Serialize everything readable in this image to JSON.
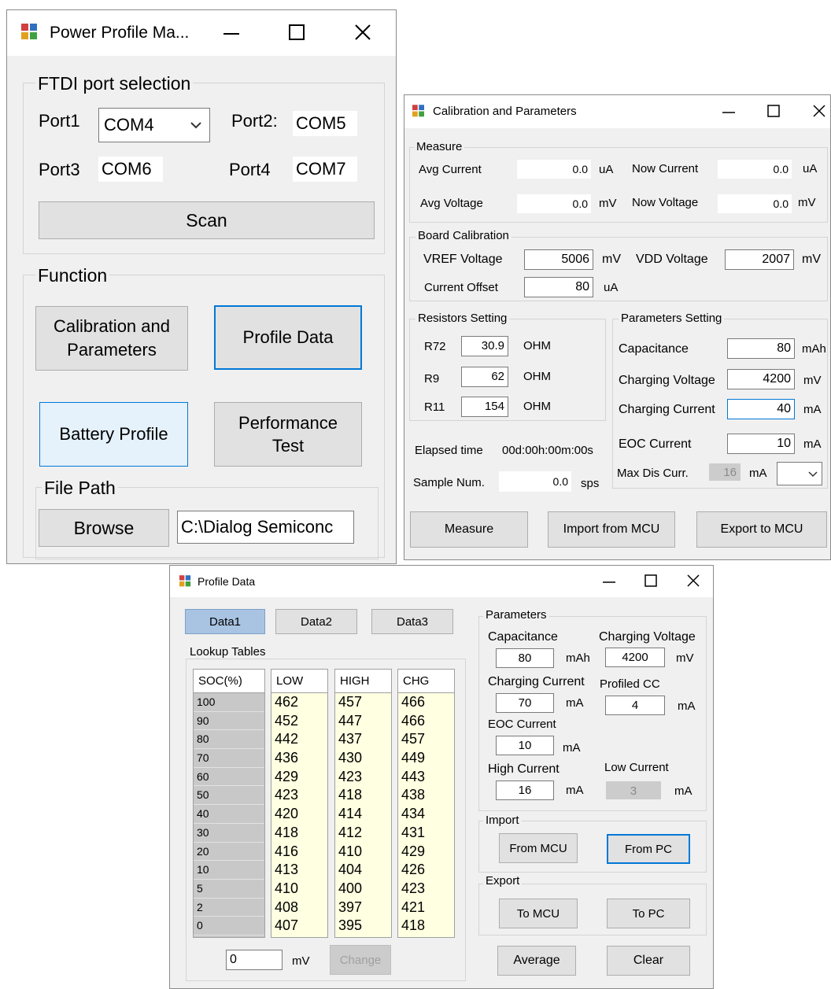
{
  "power_window": {
    "title": "Power Profile Ma...",
    "ftdi_group_label": "FTDI port selection",
    "port1_label": "Port1",
    "port1_value": "COM4",
    "port2_label": "Port2:",
    "port2_value": "COM5",
    "port3_label": "Port3",
    "port3_value": "COM6",
    "port4_label": "Port4",
    "port4_value": "COM7",
    "scan_label": "Scan",
    "function_group_label": "Function",
    "calibration_line1": "Calibration and",
    "calibration_line2": "Parameters",
    "profile_data_label": "Profile Data",
    "battery_profile_label": "Battery Profile",
    "performance_line1": "Performance",
    "performance_line2": "Test",
    "file_path_group_label": "File Path",
    "browse_label": "Browse",
    "file_path_value": "C:\\Dialog Semiconc"
  },
  "calibration_window": {
    "title": "Calibration and Parameters",
    "measure_group_label": "Measure",
    "avg_current_label": "Avg Current",
    "avg_current_value": "0.0",
    "avg_current_unit": "uA",
    "now_current_label": "Now Current",
    "now_current_value": "0.0",
    "now_current_unit": "uA",
    "avg_voltage_label": "Avg Voltage",
    "avg_voltage_value": "0.0",
    "avg_voltage_unit": "mV",
    "now_voltage_label": "Now Voltage",
    "now_voltage_value": "0.0",
    "now_voltage_unit": "mV",
    "board_group_label": "Board Calibration",
    "vref_label": "VREF Voltage",
    "vref_value": "5006",
    "vref_unit": "mV",
    "vdd_label": "VDD Voltage",
    "vdd_value": "2007",
    "vdd_unit": "mV",
    "offset_label": "Current Offset",
    "offset_value": "80",
    "offset_unit": "uA",
    "resistors_group_label": "Resistors Setting",
    "r72_label": "R72",
    "r72_value": "30.9",
    "r9_label": "R9",
    "r9_value": "62",
    "r11_label": "R11",
    "r11_value": "154",
    "ohm_unit": "OHM",
    "params_group_label": "Parameters Setting",
    "capacitance_label": "Capacitance",
    "capacitance_value": "80",
    "capacitance_unit": "mAh",
    "charging_voltage_label": "Charging Voltage",
    "charging_voltage_value": "4200",
    "charging_voltage_unit": "mV",
    "charging_current_label": "Charging Current",
    "charging_current_value": "40",
    "charging_current_unit": "mA",
    "eoc_label": "EOC Current",
    "eoc_value": "10",
    "eoc_unit": "mA",
    "max_dis_label": "Max Dis Curr.",
    "max_dis_value": "16",
    "max_dis_unit": "mA",
    "elapsed_label": "Elapsed time",
    "elapsed_value": "00d:00h:00m:00s",
    "sample_label": "Sample Num.",
    "sample_value": "0.0",
    "sample_unit": "sps",
    "measure_btn": "Measure",
    "import_btn": "Import from MCU",
    "export_btn": "Export to MCU"
  },
  "profile_window": {
    "title": "Profile Data",
    "tab_data1": "Data1",
    "tab_data2": "Data2",
    "tab_data3": "Data3",
    "lookup_label": "Lookup Tables",
    "headers": [
      "SOC(%)",
      "LOW",
      "HIGH",
      "CHG"
    ],
    "soc": [
      "100",
      "90",
      "80",
      "70",
      "60",
      "50",
      "40",
      "30",
      "20",
      "10",
      "5",
      "2",
      "0"
    ],
    "low": [
      "462",
      "452",
      "442",
      "436",
      "429",
      "423",
      "420",
      "418",
      "416",
      "413",
      "410",
      "408",
      "407"
    ],
    "high": [
      "457",
      "447",
      "437",
      "430",
      "423",
      "418",
      "414",
      "412",
      "410",
      "404",
      "400",
      "397",
      "395"
    ],
    "chg": [
      "466",
      "466",
      "457",
      "449",
      "443",
      "438",
      "434",
      "431",
      "429",
      "426",
      "423",
      "421",
      "418"
    ],
    "mv_value": "0",
    "mv_unit": "mV",
    "change_btn": "Change",
    "params_group_label": "Parameters",
    "capacitance_label": "Capacitance",
    "capacitance_value": "80",
    "capacitance_unit": "mAh",
    "charging_voltage_label": "Charging Voltage",
    "charging_voltage_value": "4200",
    "charging_voltage_unit": "mV",
    "charging_current_label": "Charging Current",
    "charging_current_value": "70",
    "charging_current_unit": "mA",
    "profiled_cc_label": "Profiled CC",
    "profiled_cc_value": "4",
    "profiled_cc_unit": "mA",
    "eoc_label": "EOC Current",
    "eoc_value": "10",
    "eoc_unit": "mA",
    "high_current_label": "High Current",
    "high_current_value": "16",
    "high_current_unit": "mA",
    "low_current_label": "Low Current",
    "low_current_value": "3",
    "low_current_unit": "mA",
    "import_group_label": "Import",
    "from_mcu_btn": "From MCU",
    "from_pc_btn": "From PC",
    "export_group_label": "Export",
    "to_mcu_btn": "To MCU",
    "to_pc_btn": "To PC",
    "average_btn": "Average",
    "clear_btn": "Clear"
  },
  "icons": {
    "window_app_icon": "app-icon",
    "minimize": "minimize-icon",
    "maximize": "maximize-icon",
    "close": "close-icon",
    "dropdown": "chevron-down-icon"
  }
}
